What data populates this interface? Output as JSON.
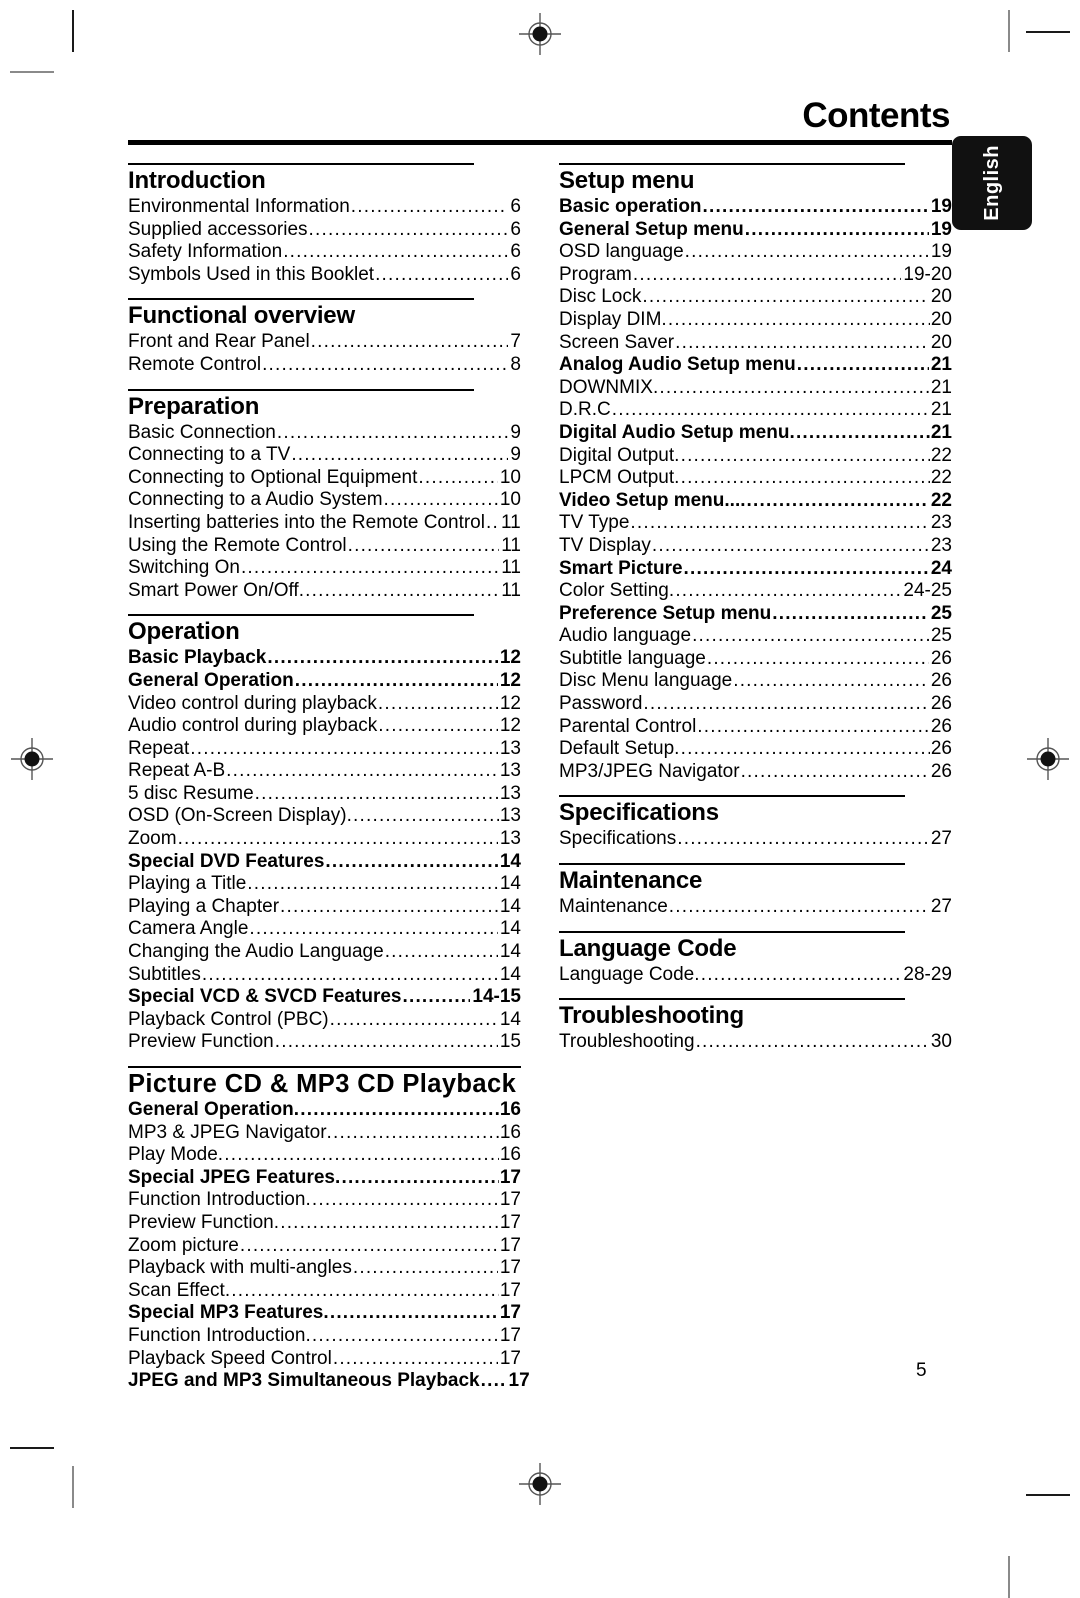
{
  "page": {
    "title": "Contents",
    "folio": "5",
    "side_tab": "English"
  },
  "columns": [
    {
      "sections": [
        {
          "heading": "Introduction",
          "entries": [
            {
              "label": "Environmental Information",
              "page": "6",
              "bold": false
            },
            {
              "label": "Supplied  accessories",
              "page": "6",
              "bold": false
            },
            {
              "label": "Safety  Information",
              "page": "6",
              "bold": false
            },
            {
              "label": "Symbols Used in this Booklet",
              "page": "6",
              "bold": false
            }
          ]
        },
        {
          "heading": "Functional overview",
          "entries": [
            {
              "label": "Front and Rear Panel",
              "page": "7",
              "bold": false
            },
            {
              "label": "Remote Control",
              "page": "8",
              "bold": false
            }
          ]
        },
        {
          "heading": "Preparation",
          "entries": [
            {
              "label": "Basic  Connection",
              "page": "9",
              "bold": false
            },
            {
              "label": "Connecting  to  a  TV",
              "page": "9",
              "bold": false
            },
            {
              "label": "Connecting to Optional Equipment",
              "page": "10",
              "bold": false
            },
            {
              "label": "Connecting to a Audio System",
              "page": "10",
              "bold": false
            },
            {
              "label": "Inserting batteries into the Remote Control",
              "page": "11",
              "bold": false,
              "leader": ".."
            },
            {
              "label": "Using the Remote Control",
              "page": "11",
              "bold": false
            },
            {
              "label": "Switching  On",
              "page": "11",
              "bold": false
            },
            {
              "label": "Smart  Power  On/Off",
              "page": "11",
              "bold": false,
              "nospace": true
            }
          ]
        },
        {
          "heading": "Operation",
          "entries": [
            {
              "label": "Basic Playback",
              "page": "12",
              "bold": true
            },
            {
              "label": "General Operation",
              "page": "12",
              "bold": true
            },
            {
              "label": "Video control during playback",
              "page": "12",
              "bold": false
            },
            {
              "label": "Audio control during playback",
              "page": "12",
              "bold": false
            },
            {
              "label": "Repeat",
              "page": "13",
              "bold": false
            },
            {
              "label": "Repeat A-B",
              "page": "13",
              "bold": false
            },
            {
              "label": "5 disc Resume",
              "page": "13",
              "bold": false
            },
            {
              "label": "OSD (On-Screen Display)",
              "page": "13",
              "bold": false,
              "nospace": true
            },
            {
              "label": "Zoom",
              "page": "13",
              "bold": false
            },
            {
              "label": "Special DVD Features",
              "page": "14",
              "bold": true
            },
            {
              "label": "Playing a Title",
              "page": "14",
              "bold": false
            },
            {
              "label": "Playing  a  Chapter",
              "page": "14",
              "bold": false
            },
            {
              "label": "Camera Angle",
              "page": "14",
              "bold": false
            },
            {
              "label": "Changing the Audio Language",
              "page": "14",
              "bold": false
            },
            {
              "label": "Subtitles",
              "page": "14",
              "bold": false
            },
            {
              "label": "Special VCD & SVCD Features",
              "page": "14-15",
              "bold": true
            },
            {
              "label": "Playback  Control  (PBC)",
              "page": "14",
              "bold": false
            },
            {
              "label": "Preview Function",
              "page": "15",
              "bold": false
            }
          ]
        },
        {
          "heading": "Picture CD & MP3 CD Playback",
          "wide": true,
          "entries": [
            {
              "label": "General  Operation",
              "page": "16",
              "bold": true,
              "nospace": true
            },
            {
              "label": "MP3 & JPEG Navigator",
              "page": "16",
              "bold": false,
              "nospace": true
            },
            {
              "label": "Play Mode",
              "page": "16",
              "bold": false,
              "nospace": true
            },
            {
              "label": "Special JPEG Features",
              "page": "17",
              "bold": true,
              "nospace": true
            },
            {
              "label": "Function Introduction",
              "page": "17",
              "bold": false,
              "nospace": true
            },
            {
              "label": "Preview Function",
              "page": "17",
              "bold": false,
              "nospace": true
            },
            {
              "label": "Zoom picture",
              "page": "17",
              "bold": false
            },
            {
              "label": "Playback with multi-angles",
              "page": "17",
              "bold": false
            },
            {
              "label": "Scan Effect",
              "page": "17",
              "bold": false,
              "nospace": true
            },
            {
              "label": "Special MP3 Features",
              "page": "17",
              "bold": true,
              "nospace": true
            },
            {
              "label": "Function  Introduction",
              "page": "17",
              "bold": false,
              "nospace": true
            },
            {
              "label": "Playback Speed Control",
              "page": "17",
              "bold": false
            },
            {
              "label": "JPEG and MP3 Simultaneous Playback",
              "page": "17",
              "bold": true,
              "leader": "...."
            }
          ]
        }
      ]
    },
    {
      "sections": [
        {
          "heading": "Setup menu",
          "entries": [
            {
              "label": "Basic operation",
              "page": "19",
              "bold": true
            },
            {
              "label": "General Setup menu",
              "page": "19",
              "bold": true
            },
            {
              "label": "OSD language",
              "page": "19",
              "bold": false
            },
            {
              "label": "Program",
              "page": "19-20",
              "bold": false
            },
            {
              "label": "Disc Lock",
              "page": "20",
              "bold": false
            },
            {
              "label": "Display DIM",
              "page": "20",
              "bold": false,
              "nospace": true
            },
            {
              "label": "Screen Saver",
              "page": "20",
              "bold": false
            },
            {
              "label": "Analog Audio Setup menu",
              "page": "21",
              "bold": true
            },
            {
              "label": "DOWNMIX",
              "page": "21",
              "bold": false,
              "nospace": true
            },
            {
              "label": "D.R.C",
              "page": "21",
              "bold": false
            },
            {
              "label": "Digital Audio Setup menu",
              "page": "21",
              "bold": true,
              "nospace": true
            },
            {
              "label": "Digital Output",
              "page": "22",
              "bold": false,
              "nospace": true
            },
            {
              "label": "LPCM Output",
              "page": "22",
              "bold": false,
              "nospace": true
            },
            {
              "label": "Video Setup menu....",
              "page": "22",
              "bold": true
            },
            {
              "label": "TV Type",
              "page": "23",
              "bold": false
            },
            {
              "label": "TV Display",
              "page": "23",
              "bold": false
            },
            {
              "label": "Smart Picture",
              "page": "24",
              "bold": true
            },
            {
              "label": "Color Setting",
              "page": "24-25",
              "bold": false,
              "nospace": true
            },
            {
              "label": "Preference Setup menu",
              "page": "25",
              "bold": true
            },
            {
              "label": "Audio  language",
              "page": "25",
              "bold": false
            },
            {
              "label": "Subtitle  language",
              "page": "26",
              "bold": false
            },
            {
              "label": "Disc Menu language",
              "page": "26",
              "bold": false
            },
            {
              "label": "Password",
              "page": "26",
              "bold": false
            },
            {
              "label": "Parental  Control",
              "page": "26",
              "bold": false
            },
            {
              "label": "Default  Setup",
              "page": "26",
              "bold": false,
              "nospace": true
            },
            {
              "label": "MP3/JPEG  Navigator",
              "page": "26",
              "bold": false
            }
          ]
        },
        {
          "heading": "Specifications",
          "entries": [
            {
              "label": "Specifications",
              "page": "27",
              "bold": false
            }
          ]
        },
        {
          "heading": "Maintenance",
          "entries": [
            {
              "label": "Maintenance",
              "page": " 27",
              "bold": false
            }
          ]
        },
        {
          "heading": "Language Code",
          "entries": [
            {
              "label": "Language Code",
              "page": " 28-29",
              "bold": false,
              "nospace": true
            }
          ]
        },
        {
          "heading": "Troubleshooting",
          "entries": [
            {
              "label": "Troubleshooting",
              "page": "30",
              "bold": false
            }
          ]
        }
      ]
    }
  ]
}
